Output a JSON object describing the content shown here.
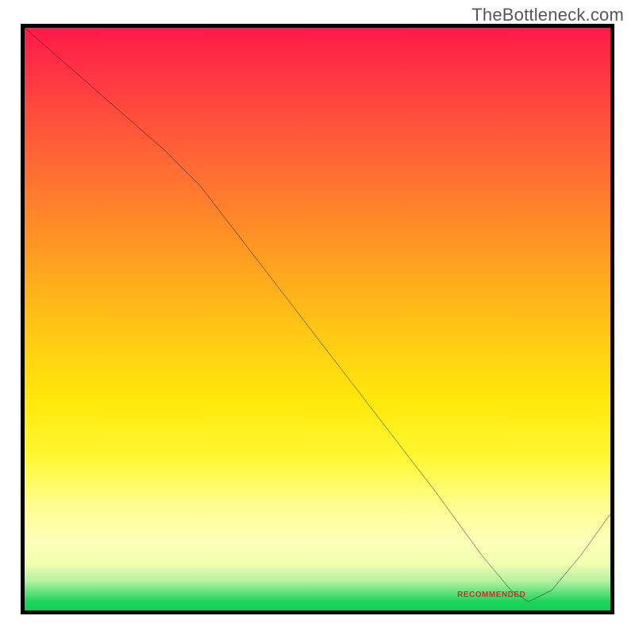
{
  "attribution": "TheBottleneck.com",
  "chart_data": {
    "type": "line",
    "title": "",
    "xlabel": "",
    "ylabel": "",
    "xlim": [
      0,
      100
    ],
    "ylim": [
      0,
      100
    ],
    "series": [
      {
        "name": "curve",
        "x": [
          0,
          8,
          16,
          24,
          30,
          40,
          50,
          60,
          70,
          78,
          83,
          86,
          90,
          95,
          100
        ],
        "y": [
          100,
          93,
          86,
          79,
          73,
          60,
          47,
          34,
          21,
          10,
          4,
          2,
          4,
          10,
          17
        ]
      }
    ],
    "minimum_point": {
      "x": 86,
      "y": 2
    },
    "annotations": [
      {
        "text_key": "datum_label",
        "x": 82,
        "y": 2
      }
    ]
  },
  "labels": {
    "datum_label": "RECOMMENDED"
  },
  "colors": {
    "curve": "#000000",
    "annotation": "#d9262c",
    "border": "#000000"
  }
}
